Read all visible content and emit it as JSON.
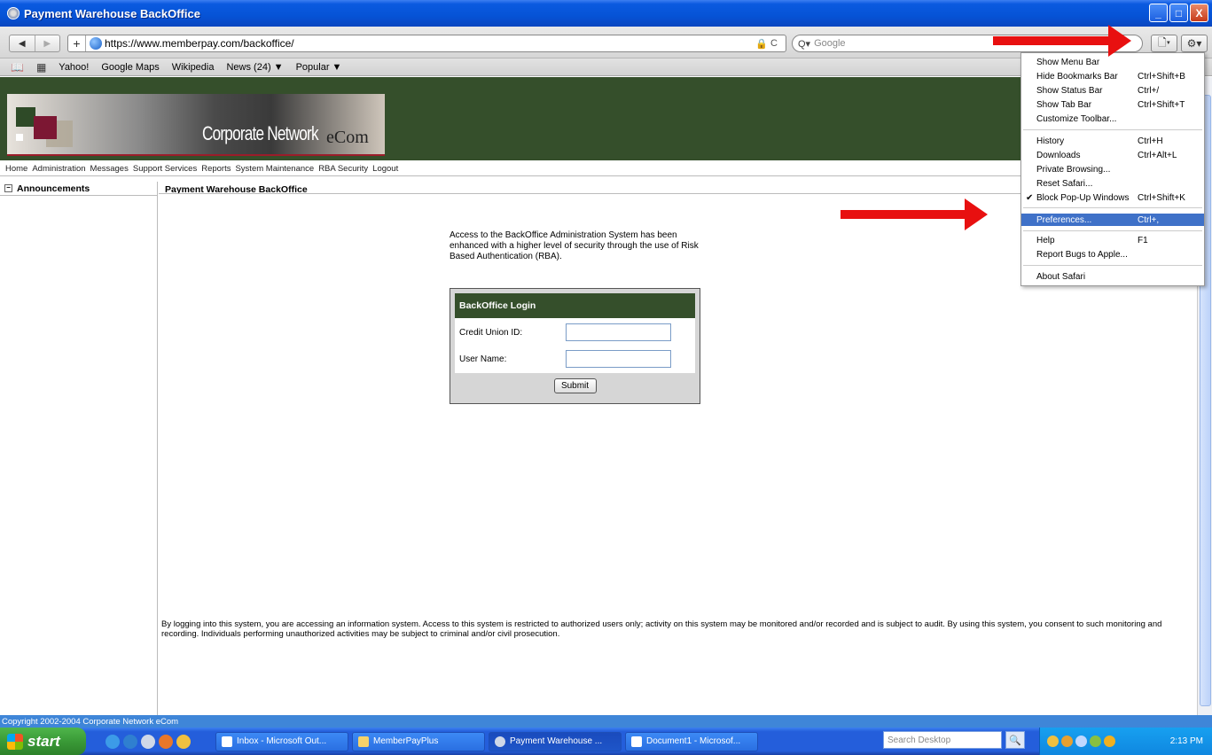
{
  "window": {
    "title": "Payment Warehouse BackOffice",
    "min": "_",
    "max": "□",
    "close": "X"
  },
  "toolbar": {
    "back": "◀",
    "forward": "▶",
    "add": "+",
    "url": "https://www.memberpay.com/backoffice/",
    "lock": "🔒",
    "reload": "C",
    "search_placeholder": "Google",
    "page_btn": "🗋▾",
    "gear_btn": "⚙▾"
  },
  "bookmarks": [
    "Yahoo!",
    "Google Maps",
    "Wikipedia",
    "News (24) ▼",
    "Popular ▼"
  ],
  "banner": {
    "logo_text": "Corporate Network",
    "logo_ecom": "eCom"
  },
  "topnav": [
    "Home",
    "Administration",
    "Messages",
    "Support Services",
    "Reports",
    "System Maintenance",
    "RBA Security",
    "Logout"
  ],
  "leftnav": {
    "expand": "−",
    "header": "Announcements"
  },
  "main": {
    "title": "Payment Warehouse BackOffice",
    "intro": "Access to the BackOffice Administration System has been enhanced with a higher level of security through the use of Risk Based Authentication (RBA).",
    "login": {
      "header": "BackOffice Login",
      "cu_label": "Credit Union ID:",
      "user_label": "User Name:",
      "cu_value": "",
      "user_value": "",
      "submit": "Submit"
    },
    "disclaimer": "By logging into this system, you are accessing an information system. Access to this system is restricted to authorized users only; activity on this system may be monitored and/or recorded and is subject to audit. By using this system, you consent to such monitoring and recording. Individuals performing unauthorized activities may be subject to criminal and/or civil prosecution."
  },
  "status": "Copyright 2002-2004 Corporate Network eCom",
  "menu": {
    "items": [
      {
        "label": "Show Menu Bar",
        "shortcut": ""
      },
      {
        "label": "Hide Bookmarks Bar",
        "shortcut": "Ctrl+Shift+B"
      },
      {
        "label": "Show Status Bar",
        "shortcut": "Ctrl+/"
      },
      {
        "label": "Show Tab Bar",
        "shortcut": "Ctrl+Shift+T"
      },
      {
        "label": "Customize Toolbar...",
        "shortcut": ""
      },
      {
        "label": "History",
        "shortcut": "Ctrl+H"
      },
      {
        "label": "Downloads",
        "shortcut": "Ctrl+Alt+L"
      },
      {
        "label": "Private Browsing...",
        "shortcut": ""
      },
      {
        "label": "Reset Safari...",
        "shortcut": ""
      },
      {
        "label": "Block Pop-Up Windows",
        "shortcut": "Ctrl+Shift+K",
        "check": "✔"
      },
      {
        "label": "Preferences...",
        "shortcut": "Ctrl+,"
      },
      {
        "label": "Help",
        "shortcut": "F1"
      },
      {
        "label": "Report Bugs to Apple...",
        "shortcut": ""
      },
      {
        "label": "About Safari",
        "shortcut": ""
      }
    ]
  },
  "taskbar": {
    "start": "start",
    "tasks": [
      "Inbox - Microsoft Out...",
      "MemberPayPlus",
      "Payment Warehouse ...",
      "Document1 - Microsof..."
    ],
    "search_placeholder": "Search Desktop",
    "search_btn": "🔍",
    "clock": "2:13 PM"
  }
}
